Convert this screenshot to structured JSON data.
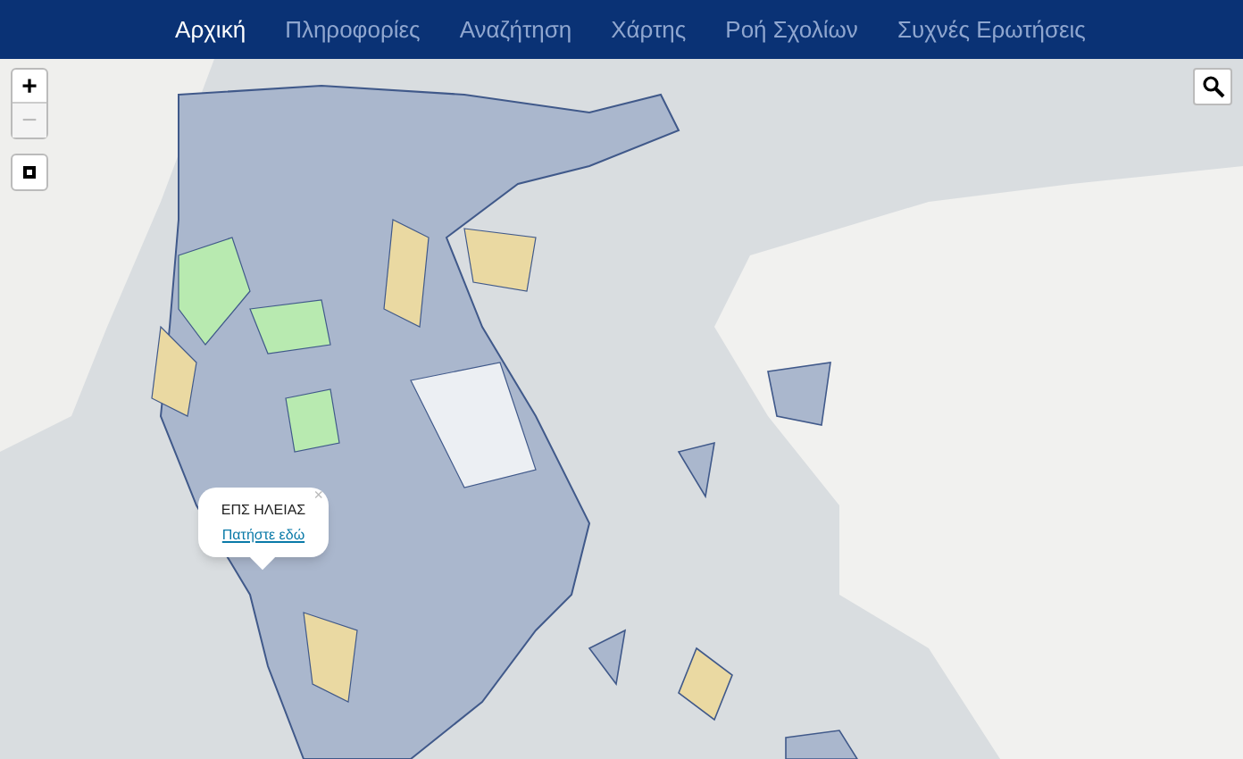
{
  "nav": [
    {
      "label": "Αρχική",
      "selected": true
    },
    {
      "label": "Πληροφορίες",
      "selected": false
    },
    {
      "label": "Αναζήτηση",
      "selected": false
    },
    {
      "label": "Χάρτης",
      "selected": false
    },
    {
      "label": "Ροή Σχολίων",
      "selected": false
    },
    {
      "label": "Συχνές Ερωτήσεις",
      "selected": false
    }
  ],
  "map": {
    "zoom_in": "+",
    "zoom_out": "−",
    "zoom_out_disabled": true,
    "popup": {
      "title": "ΕΠΣ ΗΛΕΙΑΣ",
      "link": "Πατήστε εδώ",
      "close": "×"
    }
  }
}
